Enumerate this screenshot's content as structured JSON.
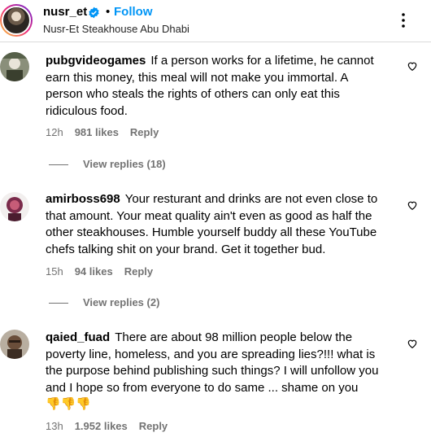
{
  "post_header": {
    "username": "nusr_et",
    "separator": "•",
    "follow_label": "Follow",
    "location": "Nusr-Et Steakhouse Abu Dhabi",
    "verified_icon": "verified-badge-icon",
    "more_icon": "more-options-icon"
  },
  "comments": [
    {
      "username": "pubgvideogames",
      "text": "If a person works for a lifetime, he cannot earn this money, this meal will not make you immortal. A person who steals the rights of others can only eat this ridiculous food.",
      "time": "12h",
      "likes": "981 likes",
      "reply_label": "Reply",
      "view_replies": "View replies (18)"
    },
    {
      "username": "amirboss698",
      "text": "Your resturant and drinks are not even close to that amount. Your meat quality ain't even as good as half the other steakhouses. Humble yourself buddy all these YouTube chefs talking shit on your brand. Get it together bud.",
      "time": "15h",
      "likes": "94 likes",
      "reply_label": "Reply",
      "view_replies": "View replies (2)"
    },
    {
      "username": "qaied_fuad",
      "text": "There are about 98 million people below the poverty line, homeless, and you are spreading lies?!!! what is the purpose behind publishing such things? I will unfollow you and I hope so from everyone to do same ... shame on you",
      "emojis": "👎👎👎",
      "time": "13h",
      "likes": "1.952 likes",
      "reply_label": "Reply"
    }
  ],
  "colors": {
    "accent": "#0095f6",
    "secondary_text": "#737373",
    "emoji": "#e2a21d"
  }
}
